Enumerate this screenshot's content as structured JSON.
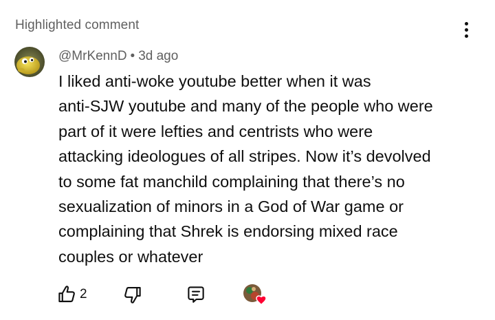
{
  "section": {
    "title": "Highlighted comment"
  },
  "comment": {
    "author": "@MrKennD",
    "separator": "•",
    "age": "3d ago",
    "lines": [
      "I liked anti-woke youtube better when it was",
      "anti-SJW youtube and many of the people who were",
      "part of it were lefties and centrists who were",
      "attacking ideologues of all stripes. Now it’s devolved",
      "to some fat manchild complaining that there’s no",
      "sexualization of minors in a God of War game or",
      "complaining that Shrek is endorsing mixed race",
      "couples or whatever"
    ],
    "avatar_icon": "yellow-creature-avatar"
  },
  "actions": {
    "like_count": "2",
    "like_icon": "thumbs-up-icon",
    "dislike_icon": "thumbs-down-icon",
    "reply_icon": "reply-comment-icon",
    "creator_heart_icon": "creator-heart-icon",
    "more_icon": "more-vertical-icon"
  },
  "colors": {
    "text": "#0f0f0f",
    "secondary_text": "#606060",
    "heart": "#ff0033"
  }
}
